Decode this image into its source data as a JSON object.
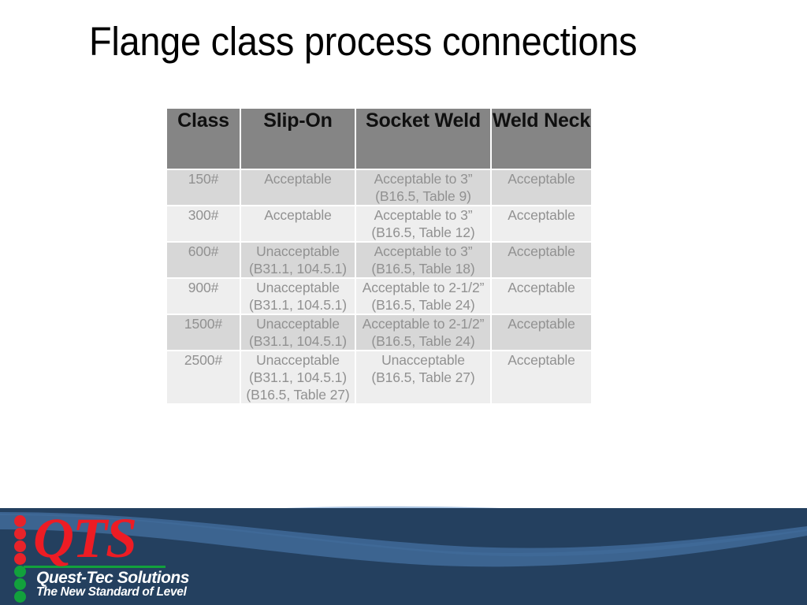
{
  "slide": {
    "title": "Flange class process connections",
    "background_color": "#ffffff"
  },
  "table": {
    "header_bg": "#858585",
    "row_dark_bg": "#d7d7d7",
    "row_light_bg": "#eeeeee",
    "text_color": "#919191",
    "columns": [
      {
        "key": "class",
        "label": "Class"
      },
      {
        "key": "slip_on",
        "label": "Slip-On"
      },
      {
        "key": "socket_weld",
        "label": "Socket Weld"
      },
      {
        "key": "weld_neck",
        "label": "Weld",
        "label2": "Neck"
      }
    ],
    "rows": [
      {
        "class": "150#",
        "slip_on": {
          "line1": "Acceptable",
          "line2": "",
          "line3": ""
        },
        "socket_weld": {
          "line1": "Acceptable to 3”",
          "line2": "(B16.5, Table 9)",
          "line3": ""
        },
        "weld_neck": {
          "line1": "Acceptable",
          "line2": "",
          "line3": ""
        }
      },
      {
        "class": "300#",
        "slip_on": {
          "line1": "Acceptable",
          "line2": "",
          "line3": ""
        },
        "socket_weld": {
          "line1": "Acceptable to 3”",
          "line2": "(B16.5, Table 12)",
          "line3": ""
        },
        "weld_neck": {
          "line1": "Acceptable",
          "line2": "",
          "line3": ""
        }
      },
      {
        "class": "600#",
        "slip_on": {
          "line1": "Unacceptable",
          "line2": "(B31.1, 104.5.1)",
          "line3": ""
        },
        "socket_weld": {
          "line1": "Acceptable to 3”",
          "line2": "(B16.5, Table 18)",
          "line3": ""
        },
        "weld_neck": {
          "line1": "Acceptable",
          "line2": "",
          "line3": ""
        }
      },
      {
        "class": "900#",
        "slip_on": {
          "line1": "Unacceptable",
          "line2": "(B31.1, 104.5.1)",
          "line3": ""
        },
        "socket_weld": {
          "line1": "Acceptable to 2-1/2”",
          "line2": "(B16.5, Table 24)",
          "line3": ""
        },
        "weld_neck": {
          "line1": "Acceptable",
          "line2": "",
          "line3": ""
        }
      },
      {
        "class": "1500#",
        "slip_on": {
          "line1": "Unacceptable",
          "line2": "(B31.1, 104.5.1)",
          "line3": ""
        },
        "socket_weld": {
          "line1": "Acceptable to 2-1/2”",
          "line2": "(B16.5, Table 24)",
          "line3": ""
        },
        "weld_neck": {
          "line1": "Acceptable",
          "line2": "",
          "line3": ""
        }
      },
      {
        "class": "2500#",
        "slip_on": {
          "line1": "Unacceptable",
          "line2": "(B31.1, 104.5.1)",
          "line3": "(B16.5, Table 27)"
        },
        "socket_weld": {
          "line1": "Unacceptable",
          "line2": "(B16.5, Table 27)",
          "line3": ""
        },
        "weld_neck": {
          "line1": "Acceptable",
          "line2": "",
          "line3": ""
        }
      }
    ]
  },
  "footer": {
    "navy_color": "#24405f",
    "wave_mid_color": "#3c6490",
    "wave_light_color": "#a9c3e0",
    "logo": {
      "mark": "QTS",
      "name": "Quest-Tec Solutions",
      "tagline": "The New Standard of Level",
      "red": "#ed1c24",
      "green": "#12a13c",
      "dots": [
        "red",
        "red",
        "red",
        "red",
        "green",
        "green",
        "green"
      ]
    }
  }
}
